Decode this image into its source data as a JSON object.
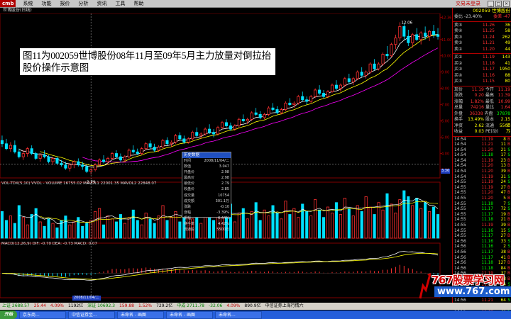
{
  "app": {
    "logo": "cmb",
    "menu": [
      "系统",
      "功能",
      "报价",
      "分析",
      "资讯",
      "工具",
      "帮助"
    ],
    "right_link": "交易未登录",
    "window_title": "世博股份(日线)"
  },
  "caption": "图11为002059世博股份08年11月至09年5月主力放量对倒拉抬股价操作示意图",
  "chart_data": [
    {
      "type": "candlestick",
      "name": "price",
      "x_label": "2008/11/04/二",
      "y_label": "3.36",
      "ohlc": [
        [
          4.8,
          5.1,
          4.4,
          4.6
        ],
        [
          4.6,
          4.9,
          4.2,
          4.3
        ],
        [
          4.3,
          4.7,
          4.1,
          4.5
        ],
        [
          4.5,
          4.8,
          4.0,
          4.1
        ],
        [
          4.1,
          4.3,
          3.7,
          3.8
        ],
        [
          3.8,
          4.2,
          3.6,
          4.0
        ],
        [
          4.0,
          4.4,
          3.8,
          4.3
        ],
        [
          4.3,
          4.5,
          3.9,
          4.0
        ],
        [
          4.0,
          4.1,
          3.6,
          3.7
        ],
        [
          3.7,
          4.0,
          3.5,
          3.9
        ],
        [
          3.9,
          4.2,
          3.7,
          3.8
        ],
        [
          3.8,
          3.9,
          3.4,
          3.5
        ],
        [
          3.5,
          3.8,
          3.3,
          3.7
        ],
        [
          3.7,
          3.8,
          3.3,
          3.4
        ],
        [
          3.4,
          3.6,
          3.2,
          3.3
        ],
        [
          3.3,
          3.5,
          3.0,
          3.1
        ],
        [
          3.1,
          3.4,
          2.9,
          3.3
        ],
        [
          3.3,
          3.6,
          3.1,
          3.5
        ],
        [
          3.5,
          3.7,
          3.2,
          3.3
        ],
        [
          3.3,
          3.5,
          3.0,
          3.2
        ],
        [
          3.2,
          3.3,
          2.8,
          2.9
        ],
        [
          2.9,
          3.1,
          2.7,
          3.0
        ],
        [
          3.0,
          3.4,
          2.9,
          3.3
        ],
        [
          3.3,
          3.7,
          3.2,
          3.6
        ],
        [
          3.6,
          3.9,
          3.4,
          3.5
        ],
        [
          3.5,
          3.8,
          3.3,
          3.7
        ],
        [
          3.7,
          4.1,
          3.6,
          4.0
        ],
        [
          4.0,
          4.2,
          3.7,
          3.8
        ],
        [
          3.8,
          4.0,
          3.5,
          3.6
        ],
        [
          3.6,
          3.9,
          3.5,
          3.8
        ],
        [
          3.8,
          4.3,
          3.7,
          4.2
        ],
        [
          4.2,
          4.5,
          4.0,
          4.1
        ],
        [
          4.1,
          4.3,
          3.9,
          4.0
        ],
        [
          4.0,
          4.4,
          3.9,
          4.3
        ],
        [
          4.3,
          4.7,
          4.2,
          4.6
        ],
        [
          4.6,
          4.8,
          4.3,
          4.4
        ],
        [
          4.4,
          4.6,
          4.1,
          4.2
        ],
        [
          4.2,
          4.5,
          4.1,
          4.4
        ],
        [
          4.4,
          4.9,
          4.3,
          4.8
        ],
        [
          4.8,
          5.0,
          4.5,
          4.6
        ],
        [
          4.6,
          4.8,
          4.4,
          4.7
        ],
        [
          4.7,
          5.2,
          4.6,
          5.1
        ],
        [
          5.1,
          5.3,
          4.8,
          4.9
        ],
        [
          4.9,
          5.1,
          4.6,
          4.7
        ],
        [
          4.7,
          5.0,
          4.6,
          4.9
        ],
        [
          4.9,
          5.4,
          4.8,
          5.3
        ],
        [
          5.3,
          5.6,
          5.0,
          5.1
        ],
        [
          5.1,
          5.3,
          4.9,
          5.2
        ],
        [
          5.2,
          5.6,
          5.1,
          5.5
        ],
        [
          5.5,
          5.8,
          5.2,
          5.3
        ],
        [
          5.3,
          5.5,
          5.0,
          5.2
        ],
        [
          5.2,
          5.7,
          5.1,
          5.6
        ],
        [
          5.6,
          6.0,
          5.5,
          5.9
        ],
        [
          5.9,
          6.1,
          5.6,
          5.7
        ],
        [
          5.7,
          5.9,
          5.4,
          5.5
        ],
        [
          5.5,
          5.8,
          5.4,
          5.7
        ],
        [
          5.7,
          6.2,
          5.6,
          6.1
        ],
        [
          6.1,
          6.4,
          5.9,
          6.0
        ],
        [
          6.0,
          6.2,
          5.8,
          6.1
        ],
        [
          6.1,
          6.6,
          6.0,
          6.5
        ],
        [
          6.5,
          6.8,
          6.3,
          6.4
        ],
        [
          6.4,
          6.6,
          6.1,
          6.2
        ],
        [
          6.2,
          6.5,
          6.1,
          6.4
        ],
        [
          6.4,
          6.9,
          6.3,
          6.8
        ],
        [
          6.8,
          7.1,
          6.6,
          6.7
        ],
        [
          6.7,
          6.9,
          6.4,
          6.5
        ],
        [
          6.5,
          6.8,
          6.4,
          6.7
        ],
        [
          6.7,
          7.2,
          6.6,
          7.1
        ],
        [
          7.1,
          7.4,
          6.9,
          7.0
        ],
        [
          7.0,
          7.2,
          6.8,
          7.1
        ],
        [
          7.1,
          7.6,
          7.0,
          7.5
        ],
        [
          7.5,
          7.8,
          7.2,
          7.3
        ],
        [
          7.3,
          7.5,
          7.0,
          7.2
        ],
        [
          7.2,
          7.6,
          7.1,
          7.5
        ],
        [
          7.5,
          8.0,
          7.4,
          7.9
        ],
        [
          7.9,
          8.2,
          7.6,
          7.7
        ],
        [
          7.7,
          7.9,
          7.4,
          7.5
        ],
        [
          7.5,
          7.9,
          7.4,
          7.8
        ],
        [
          7.8,
          8.3,
          7.7,
          8.2
        ],
        [
          8.2,
          8.5,
          7.9,
          8.0
        ],
        [
          8.0,
          8.3,
          7.8,
          8.2
        ],
        [
          8.2,
          8.7,
          8.1,
          8.6
        ],
        [
          8.6,
          8.9,
          8.3,
          8.4
        ],
        [
          8.4,
          8.7,
          8.2,
          8.6
        ],
        [
          8.6,
          9.1,
          8.5,
          9.0
        ],
        [
          9.0,
          9.3,
          8.7,
          8.8
        ],
        [
          8.8,
          9.1,
          8.6,
          9.0
        ],
        [
          9.0,
          9.6,
          8.9,
          9.5
        ],
        [
          9.5,
          9.8,
          9.1,
          9.2
        ],
        [
          9.2,
          9.6,
          9.1,
          9.5
        ],
        [
          9.5,
          10.2,
          9.4,
          10.1
        ],
        [
          10.1,
          10.6,
          9.8,
          10.0
        ],
        [
          10.0,
          10.8,
          9.9,
          10.7
        ],
        [
          10.7,
          11.3,
          10.4,
          11.1
        ],
        [
          11.1,
          12.06,
          10.9,
          11.8
        ],
        [
          11.8,
          12.0,
          11.0,
          11.2
        ],
        [
          11.2,
          11.6,
          10.6,
          10.8
        ],
        [
          10.8,
          11.4,
          10.5,
          11.3
        ],
        [
          11.3,
          11.7,
          10.9,
          11.0
        ],
        [
          11.0,
          11.5,
          10.7,
          11.4
        ],
        [
          11.4,
          11.8,
          11.0,
          11.2
        ],
        [
          11.2,
          11.6,
          10.9,
          11.5
        ],
        [
          11.5,
          11.9,
          11.1,
          11.3
        ],
        [
          11.3,
          11.7,
          11.0,
          11.19
        ]
      ],
      "ma": {
        "ma5": "white",
        "ma10": "yellow",
        "ma20": "magenta"
      },
      "high_label": "12.06",
      "low_label": "2.79",
      "y_ticks": [
        "12.36",
        "11.00",
        "10.00",
        "9.00",
        "8.00",
        "7.00",
        "6.00",
        "5.00",
        "4.00",
        "3.00"
      ]
    },
    {
      "type": "bar",
      "name": "volume",
      "label": "VOL-TDX(5,10) VVOL - VOLUME 16755.02 MAVOL1 22001.35 MAVOL2 22848.07",
      "values": [
        18,
        12,
        15,
        10,
        22,
        14,
        9,
        16,
        20,
        11,
        8,
        13,
        10,
        7,
        12,
        15,
        9,
        11,
        14,
        8,
        10,
        12,
        18,
        20,
        9,
        15,
        13,
        11,
        16,
        10,
        14,
        19,
        12,
        9,
        17,
        13,
        10,
        15,
        22,
        12,
        14,
        18,
        11,
        16,
        20,
        13,
        17,
        10,
        15,
        21,
        12,
        16,
        19,
        14,
        23,
        11,
        17,
        20,
        13,
        18,
        24,
        12,
        19,
        15,
        22,
        17,
        13,
        25,
        16,
        20,
        14,
        23,
        18,
        15,
        26,
        19,
        14,
        21,
        17,
        24,
        16,
        27,
        20,
        15,
        22,
        18,
        28,
        21,
        16,
        24,
        19,
        30,
        23,
        17,
        26,
        32,
        28,
        22,
        27,
        20,
        24,
        18,
        21,
        16,
        14,
        17
      ]
    },
    {
      "type": "line",
      "name": "macd",
      "label": "MACD(12,26,9) DIF: -0.70 DEA: -0.73 MACD: 0.07"
    }
  ],
  "infobox": {
    "title": "历史数据",
    "rows": [
      {
        "k": "时间",
        "v": "2008/11/04/二"
      },
      {
        "k": "数值",
        "v": "3.047"
      },
      {
        "k": "开盘价",
        "v": "2.98"
      },
      {
        "k": "最高价",
        "v": "2.98"
      },
      {
        "k": "最低价",
        "v": "2.79"
      },
      {
        "k": "收盘价",
        "v": "2.85"
      },
      {
        "k": "成交量",
        "v": "10754"
      },
      {
        "k": "成交额",
        "v": "301.1万"
      },
      {
        "k": "涨跌",
        "v": "-0.10"
      },
      {
        "k": "涨幅",
        "v": "-3.39%"
      },
      {
        "k": "振幅",
        "v": "6.44%"
      },
      {
        "k": "换手率",
        "v": "4.42%"
      },
      {
        "k": "流通股",
        "v": "5500万"
      }
    ]
  },
  "quote": {
    "code_name": "002059 世博股份",
    "weibi": "委比 -23.40%",
    "weicha": "委差 -47",
    "sells": [
      {
        "l": "卖⑤",
        "p": "11.26",
        "q": "36"
      },
      {
        "l": "卖④",
        "p": "11.25",
        "q": "58"
      },
      {
        "l": "卖③",
        "p": "11.24",
        "q": "262"
      },
      {
        "l": "卖②",
        "p": "11.21",
        "q": "49"
      },
      {
        "l": "卖①",
        "p": "11.20",
        "q": "44"
      }
    ],
    "buys": [
      {
        "l": "买①",
        "p": "11.19",
        "q": "143"
      },
      {
        "l": "买②",
        "p": "11.18",
        "q": "41"
      },
      {
        "l": "买③",
        "p": "11.17",
        "q": "1950"
      },
      {
        "l": "买④",
        "p": "11.16",
        "q": "88"
      },
      {
        "l": "买⑤",
        "p": "11.15",
        "q": "80"
      }
    ],
    "stats": [
      {
        "l": "现价",
        "v": "11.19",
        "l2": "今开",
        "v2": "11.19"
      },
      {
        "l": "涨跌",
        "v": "0.20",
        "l2": "最高",
        "v2": "11.39"
      },
      {
        "l": "涨幅",
        "v": "1.82%",
        "l2": "最低",
        "v2": "10.99"
      },
      {
        "l": "总量",
        "v": "74216",
        "l2": "量比",
        "v2": "1.64"
      },
      {
        "l": "外盘",
        "v": "36338",
        "l2": "内盘",
        "v2": "37878"
      },
      {
        "l": "换手",
        "v": "13.49%",
        "l2": "股本",
        "v2": "2.15亿"
      },
      {
        "l": "净资",
        "v": "2.62",
        "l2": "流通",
        "v2": "5500万"
      },
      {
        "l": "收益",
        "v": "0.03",
        "l2": "PE(动)",
        "v2": "-"
      }
    ],
    "ticks": [
      [
        "14:54",
        "11.19",
        "8",
        "B"
      ],
      [
        "14:54",
        "11.21",
        "11",
        "B"
      ],
      [
        "14:54",
        "11.20",
        "21",
        "S"
      ],
      [
        "14:54",
        "11.18",
        "17",
        "S"
      ],
      [
        "14:54",
        "11.19",
        "23",
        "B"
      ],
      [
        "14:54",
        "11.20",
        "13",
        "B"
      ],
      [
        "14:54",
        "11.20",
        "39",
        "B"
      ],
      [
        "14:54",
        "11.19",
        "31",
        "S"
      ],
      [
        "14:55",
        "11.19",
        "24",
        "S"
      ],
      [
        "14:55",
        "11.19",
        "27",
        "B"
      ],
      [
        "14:55",
        "11.20",
        "47",
        "B"
      ],
      [
        "14:55",
        "11.20",
        "5",
        "B"
      ],
      [
        "14:55",
        "11.18",
        "7",
        "S"
      ],
      [
        "14:55",
        "11.17",
        "72",
        "S"
      ],
      [
        "14:55",
        "11.17",
        "19",
        "B"
      ],
      [
        "14:55",
        "11.18",
        "21",
        "B"
      ],
      [
        "14:55",
        "11.19",
        "39",
        "B"
      ],
      [
        "14:55",
        "11.16",
        "15",
        "S"
      ],
      [
        "14:55",
        "11.17",
        "27",
        "B"
      ],
      [
        "14:56",
        "11.16",
        "33",
        "S"
      ],
      [
        "14:56",
        "11.16",
        "2",
        "S"
      ],
      [
        "14:56",
        "11.17",
        "38",
        "B"
      ],
      [
        "14:56",
        "11.17",
        "41",
        "B"
      ],
      [
        "14:56",
        "11.18",
        "127",
        "B"
      ],
      [
        "14:56",
        "11.18",
        "84",
        "B"
      ],
      [
        "14:56",
        "11.19",
        "37",
        "B"
      ],
      [
        "14:56",
        "11.19",
        "18",
        "B"
      ],
      [
        "14:56",
        "11.19",
        "4",
        "S"
      ],
      [
        "14:56",
        "11.20",
        "45",
        "B"
      ],
      [
        "14:56",
        "11.22",
        "229",
        "B"
      ],
      [
        "14:56",
        "11.21",
        "64",
        "S"
      ],
      [
        "14:56",
        "11.20",
        "66",
        "S"
      ],
      [
        "14:56",
        "11.19",
        "31",
        "S"
      ]
    ]
  },
  "status": {
    "items": [
      "上证 2688.57",
      "25.44",
      "4.09%",
      "1192亿",
      "深证 10692.3",
      "159.88",
      "1.52%",
      "729.2亿",
      "中成 2711.78",
      "-32.06",
      "4.09%",
      "890.9亿"
    ],
    "marquee": "中信证券上海行情六"
  },
  "taskbar": {
    "start": "开始",
    "tasks": [
      "京东商...",
      "中信证券至...",
      "未命名 - 画图",
      "未命名 - 画图",
      "未命名..."
    ]
  },
  "watermark": {
    "line1": "767股票学习网",
    "line2": "www.767.com"
  }
}
